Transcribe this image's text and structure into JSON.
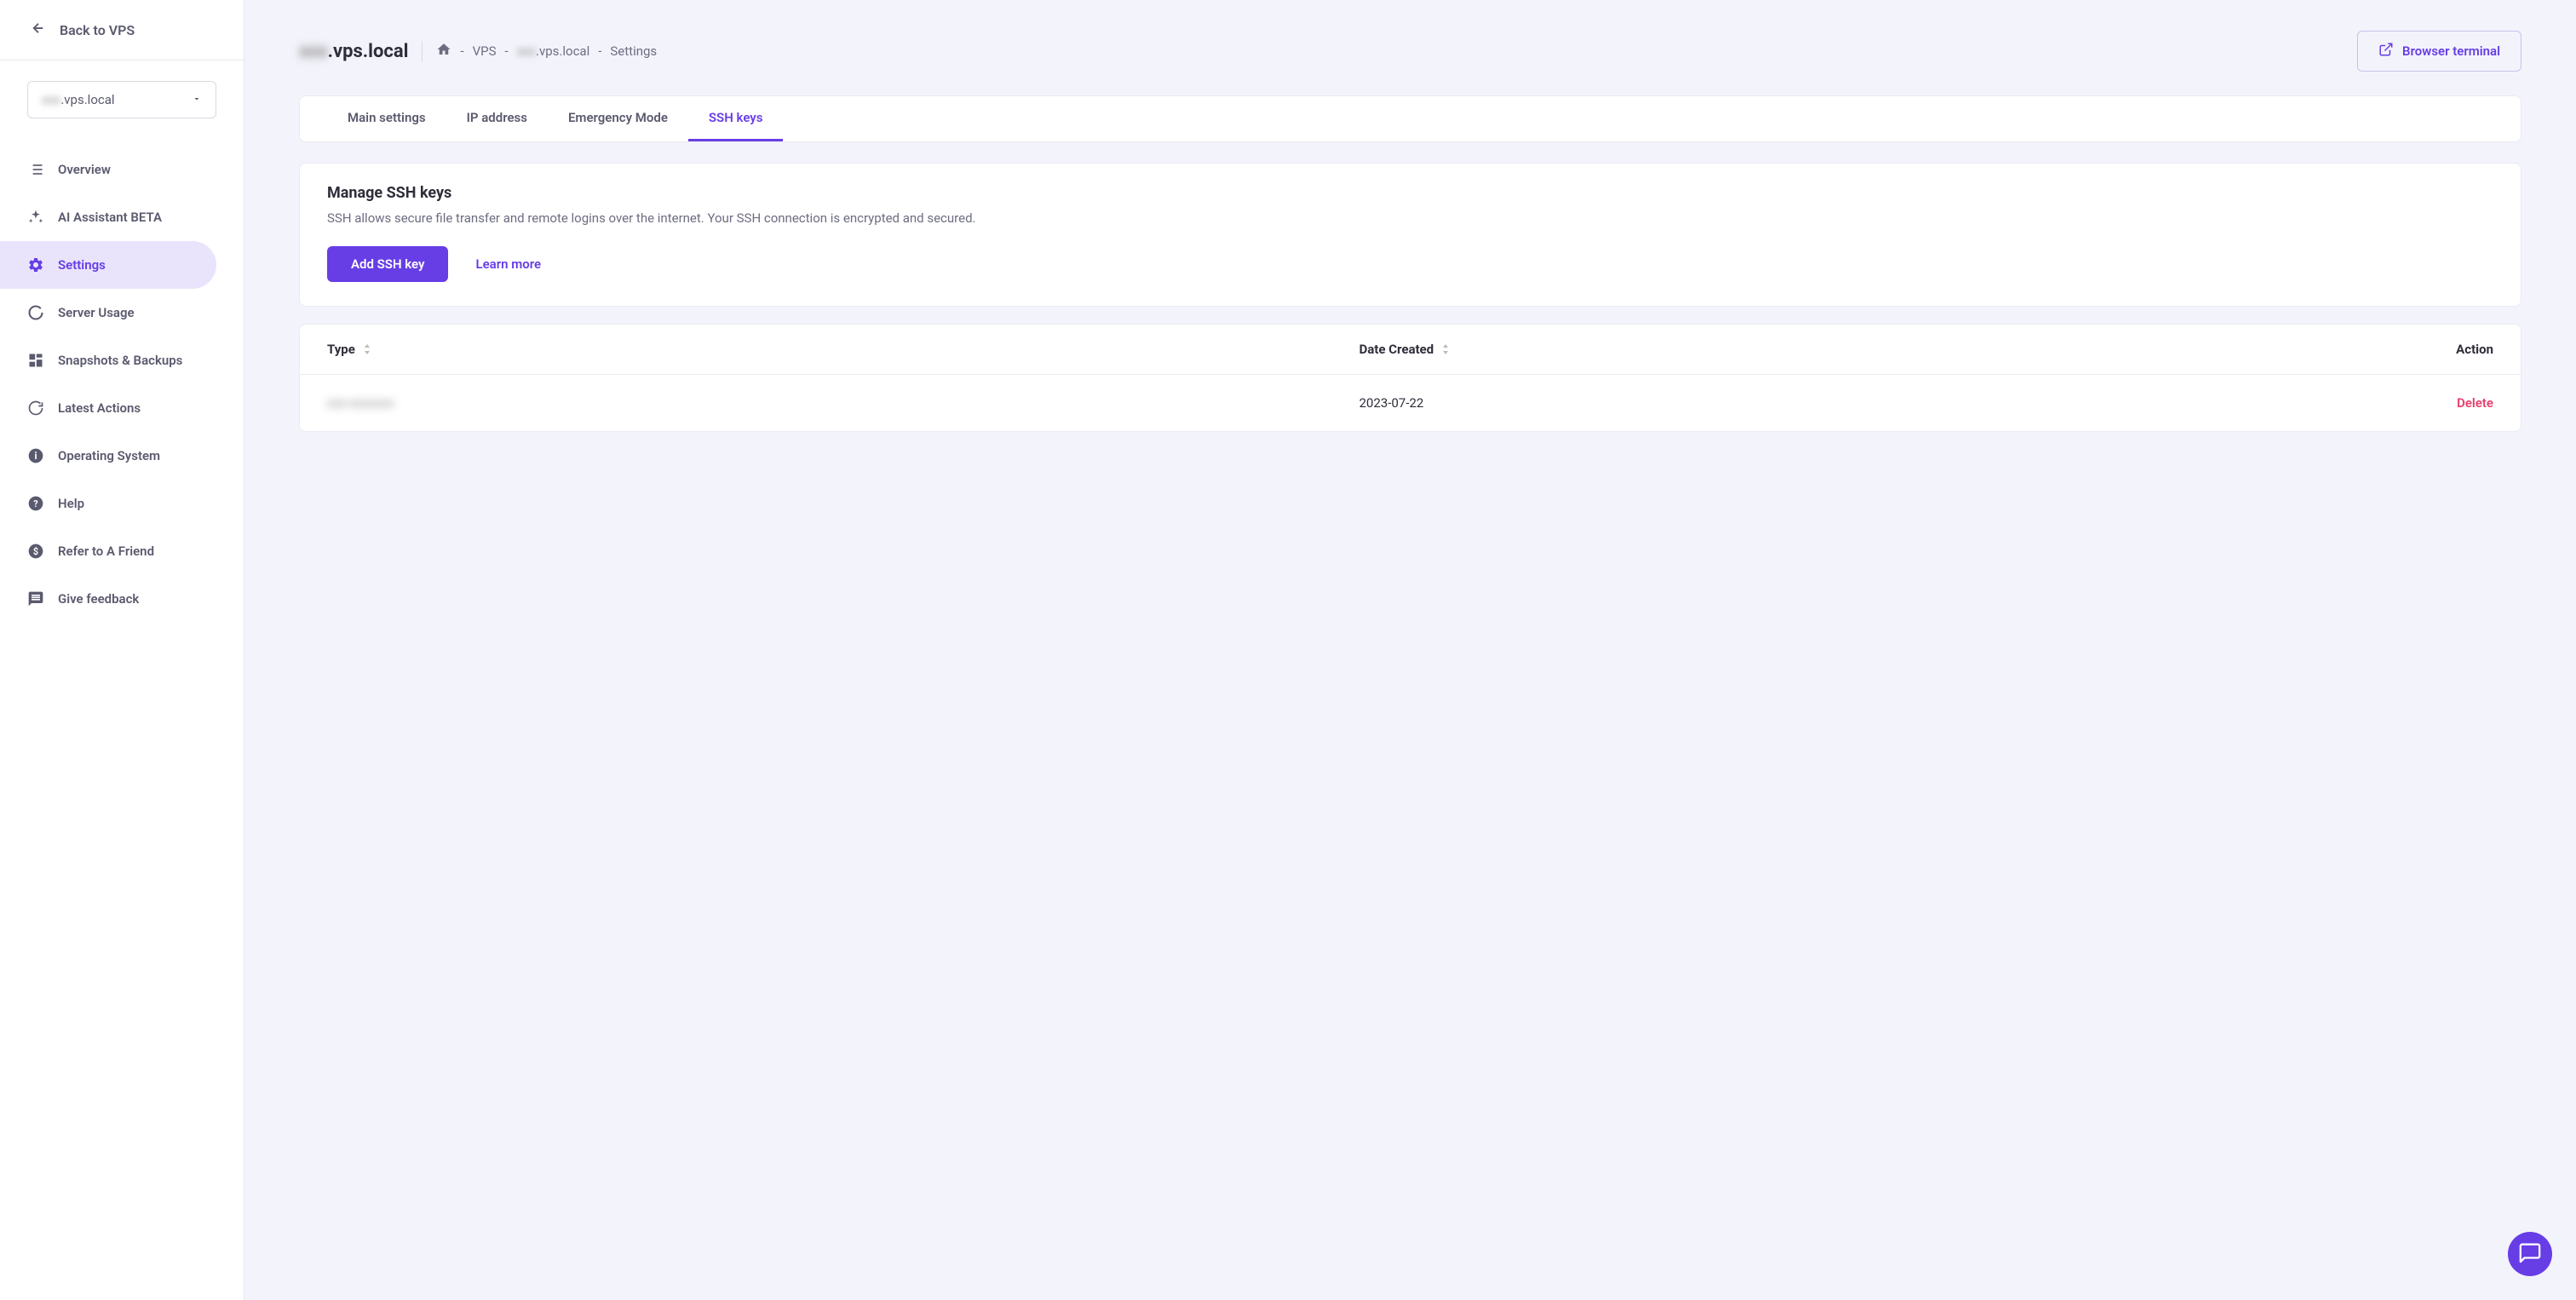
{
  "sidebar": {
    "back_label": "Back to VPS",
    "server_selector_prefix": "xxx",
    "server_selector_suffix": ".vps.local",
    "items": [
      {
        "label": "Overview"
      },
      {
        "label": "AI Assistant BETA"
      },
      {
        "label": "Settings"
      },
      {
        "label": "Server Usage"
      },
      {
        "label": "Snapshots & Backups"
      },
      {
        "label": "Latest Actions"
      },
      {
        "label": "Operating System"
      },
      {
        "label": "Help"
      },
      {
        "label": "Refer to A Friend"
      },
      {
        "label": "Give feedback"
      }
    ]
  },
  "header": {
    "title_prefix": "xxx",
    "title_suffix": ".vps.local",
    "breadcrumb": {
      "vps": "VPS",
      "server_prefix": "xxx",
      "server_suffix": ".vps.local",
      "page": "Settings"
    },
    "terminal_button": "Browser terminal"
  },
  "tabs": [
    {
      "label": "Main settings"
    },
    {
      "label": "IP address"
    },
    {
      "label": "Emergency Mode"
    },
    {
      "label": "SSH keys"
    }
  ],
  "manage": {
    "title": "Manage SSH keys",
    "description": "SSH allows secure file transfer and remote logins over the internet. Your SSH connection is encrypted and secured.",
    "add_button": "Add SSH key",
    "learn_more": "Learn more"
  },
  "table": {
    "headers": {
      "type": "Type",
      "date_created": "Date Created",
      "action": "Action"
    },
    "rows": [
      {
        "type": "xxx-xxxxxxx",
        "date_created": "2023-07-22",
        "action": "Delete"
      }
    ]
  }
}
